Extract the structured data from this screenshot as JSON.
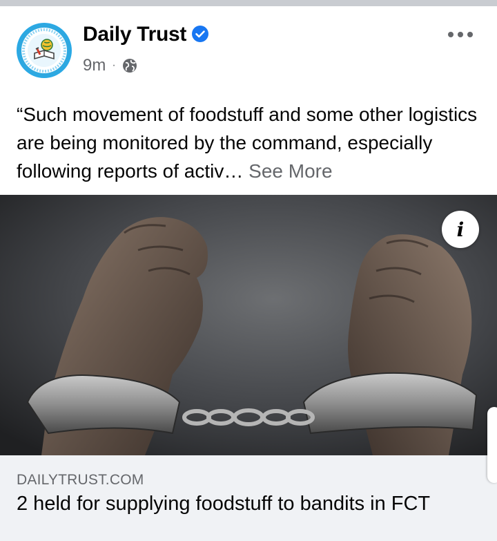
{
  "post": {
    "page_name": "Daily Trust",
    "timestamp": "9m",
    "separator": "·",
    "privacy_icon": "globe-icon",
    "verified_icon": "verified-badge-icon",
    "more_icon": "more-dots-icon",
    "text": "“Such movement of foodstuff and some other logistics are being monitored by the command, especially following reports of activ…",
    "see_more_label": "See More"
  },
  "image": {
    "description_icon": "info-icon",
    "info_label": "i"
  },
  "link_preview": {
    "domain": "DAILYTRUST.COM",
    "title": "2 held for supplying foodstuff to bandits in FCT"
  },
  "colors": {
    "brand_blue": "#1877f2",
    "avatar_blue": "#29a9e6",
    "secondary_text": "#65676b",
    "primary_text": "#050505",
    "preview_bg": "#f0f2f5"
  }
}
